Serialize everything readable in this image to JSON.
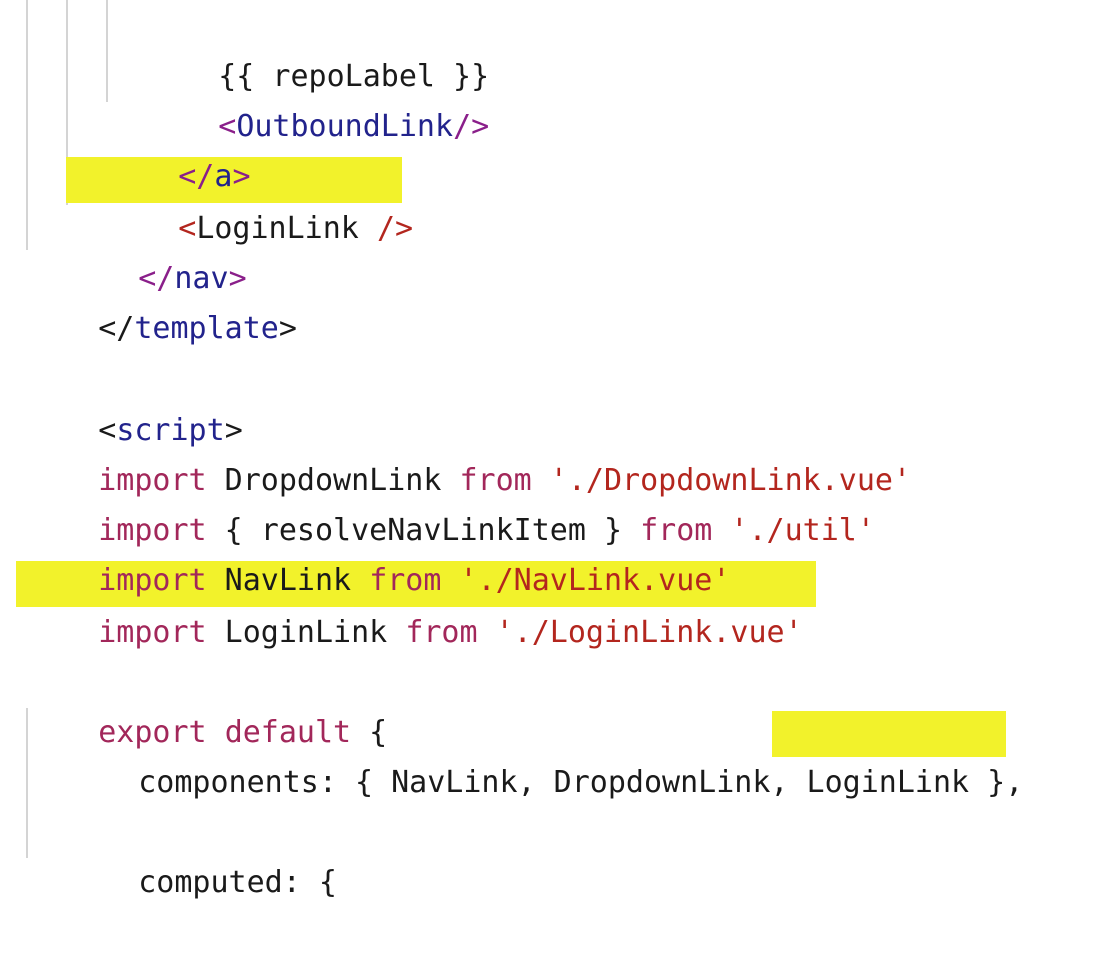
{
  "editor": {
    "colors": {
      "background": "#ffffff",
      "highlight": "#f2f22b",
      "tag": "#22238c",
      "punctuation": "#8a1f8a",
      "keyword": "#a2275a",
      "string": "#b3261e",
      "text": "#1a1a1a",
      "indent_guide": "#d4d4d4"
    },
    "lines": [
      {
        "tokens": [
          "{{ repoLabel }}"
        ]
      },
      {
        "tokens": [
          "<",
          "OutboundLink",
          "/>"
        ]
      },
      {
        "tokens": [
          "</",
          "a",
          ">"
        ]
      },
      {
        "tokens": [
          "<",
          "LoginLink ",
          "/>"
        ]
      },
      {
        "tokens": [
          "</",
          "nav",
          ">"
        ]
      },
      {
        "tokens": [
          "</",
          "template",
          ">"
        ]
      },
      {
        "tokens": []
      },
      {
        "tokens": [
          "<",
          "script",
          ">"
        ]
      },
      {
        "tokens": [
          "import",
          " DropdownLink ",
          "from",
          " './DropdownLink.vue'"
        ]
      },
      {
        "tokens": [
          "import",
          " { resolveNavLinkItem } ",
          "from",
          " './util'"
        ]
      },
      {
        "tokens": [
          "import",
          " NavLink ",
          "from",
          " './NavLink.vue'"
        ]
      },
      {
        "tokens": [
          "import",
          " LoginLink ",
          "from",
          " './LoginLink.vue'"
        ]
      },
      {
        "tokens": []
      },
      {
        "tokens": [
          "export",
          " ",
          "default",
          " {"
        ]
      },
      {
        "tokens": [
          "components: { NavLink, DropdownLink",
          ", LoginLink",
          " },"
        ]
      },
      {
        "tokens": []
      },
      {
        "tokens": [
          "computed: {"
        ]
      }
    ]
  }
}
